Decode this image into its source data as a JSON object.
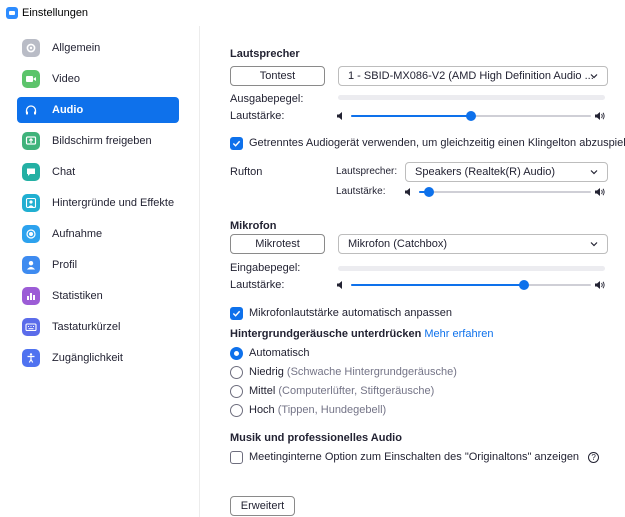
{
  "window": {
    "title": "Einstellungen"
  },
  "colors": {
    "accent": "#0E71EB",
    "active_bg": "#0E71EB"
  },
  "sidebar": {
    "items": [
      {
        "label": "Allgemein",
        "icon": "gear-icon",
        "color": "#B9BCC6"
      },
      {
        "label": "Video",
        "icon": "video-camera-icon",
        "color": "#5CC46B"
      },
      {
        "label": "Audio",
        "icon": "headphones-icon",
        "color": "#0E71EB",
        "active": true
      },
      {
        "label": "Bildschirm freigeben",
        "icon": "share-screen-icon",
        "color": "#3FB37B"
      },
      {
        "label": "Chat",
        "icon": "chat-bubble-icon",
        "color": "#24B0A4"
      },
      {
        "label": "Hintergründe und Effekte",
        "icon": "person-background-icon",
        "color": "#21AFD1"
      },
      {
        "label": "Aufnahme",
        "icon": "record-icon",
        "color": "#2DA2EE"
      },
      {
        "label": "Profil",
        "icon": "profile-icon",
        "color": "#3E8BF0"
      },
      {
        "label": "Statistiken",
        "icon": "bar-chart-icon",
        "color": "#9C5CD6"
      },
      {
        "label": "Tastaturkürzel",
        "icon": "keyboard-icon",
        "color": "#5B6CEA"
      },
      {
        "label": "Zugänglichkeit",
        "icon": "accessibility-icon",
        "color": "#4F72F0"
      }
    ]
  },
  "speaker": {
    "heading": "Lautsprecher",
    "test_button": "Tontest",
    "device": "1 - SBID-MX086-V2 (AMD High Definition Audio ...",
    "output_level_label": "Ausgabepegel:",
    "volume_label": "Lautstärke:",
    "volume": 0.5,
    "separate_device_label": "Getrenntes Audiogerät verwenden, um gleichzeitig einen Klingelton abzuspielen",
    "separate_device_checked": true,
    "ringtone_label": "Rufton",
    "ringtone_speaker_label": "Lautsprecher:",
    "ringtone_device": "Speakers (Realtek(R) Audio)",
    "ringtone_volume_label": "Lautstärke:",
    "ringtone_volume": 0.06
  },
  "microphone": {
    "heading": "Mikrofon",
    "test_button": "Mikrotest",
    "device": "Mikrofon (Catchbox)",
    "input_level_label": "Eingabepegel:",
    "volume_label": "Lautstärke:",
    "volume": 0.72,
    "auto_adjust_label": "Mikrofonlautstärke automatisch anpassen",
    "auto_adjust_checked": true
  },
  "noise": {
    "heading": "Hintergrundgeräusche unterdrücken",
    "learn_more": "Mehr erfahren",
    "options": [
      {
        "label": "Automatisch",
        "hint": "",
        "selected": true
      },
      {
        "label": "Niedrig",
        "hint": "(Schwache Hintergrundgeräusche)",
        "selected": false
      },
      {
        "label": "Mittel",
        "hint": "(Computerlüfter, Stiftgeräusche)",
        "selected": false
      },
      {
        "label": "Hoch",
        "hint": "(Tippen, Hundegebell)",
        "selected": false
      }
    ]
  },
  "music": {
    "heading": "Musik und professionelles Audio",
    "original_sound_label": "Meetinginterne Option zum Einschalten des \"Originaltons\" anzeigen",
    "original_sound_checked": false,
    "help_glyph": "?"
  },
  "advanced_button": "Erweitert"
}
